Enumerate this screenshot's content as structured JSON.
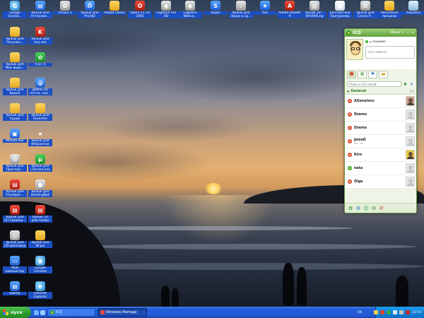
{
  "desktop_icons": [
    {
      "label": "Google Онлай...",
      "glyph": "G",
      "style": "g-globe",
      "icon": "google-online-icon"
    },
    {
      "label": "Ярлык для Установи...",
      "glyph": "▤",
      "style": "g-blue",
      "icon": "installer-shortcut-icon"
    },
    {
      "label": "Picasa 3",
      "glyph": "✿",
      "style": "g-gray",
      "icon": "picasa-icon"
    },
    {
      "label": "Ярлык для PrintID",
      "glyph": "⎙",
      "style": "g-blue",
      "icon": "printid-shortcut-icon"
    },
    {
      "label": "Новая папка",
      "glyph": "",
      "style": "g-folder",
      "icon": "folder-icon"
    },
    {
      "label": "Opera 11.10 2092",
      "glyph": "O",
      "style": "g-red",
      "icon": "opera-icon"
    },
    {
      "label": "Logitech Vid HD",
      "glyph": "◉",
      "style": "g-gray",
      "icon": "logitech-video-icon"
    },
    {
      "label": "Logitech Webca...",
      "glyph": "◉",
      "style": "g-gray",
      "icon": "logitech-webcam-icon"
    },
    {
      "label": "Skype",
      "glyph": "S",
      "style": "g-blue",
      "icon": "skype-icon"
    },
    {
      "label": "Ярлык для Звуки и ау...",
      "glyph": "♪",
      "style": "g-gray",
      "icon": "sounds-shortcut-icon"
    },
    {
      "label": "dvk",
      "glyph": "★",
      "style": "g-blue",
      "icon": "dvk-icon"
    },
    {
      "label": "Adobe Reader 9",
      "glyph": "A",
      "style": "g-red",
      "icon": "adobe-reader-icon"
    },
    {
      "label": "Архив ZIP - WinRAR.zip",
      "glyph": "▥",
      "style": "g-gray",
      "icon": "winrar-archive-icon"
    },
    {
      "label": "Бесплатные Программы Ру",
      "glyph": "▦",
      "style": "g-doc",
      "icon": "free-programs-icon"
    },
    {
      "label": "Ярлык для Canon P...",
      "glyph": "⎙",
      "style": "g-gray",
      "icon": "canon-shortcut-icon"
    },
    {
      "label": "Несколько ярлыков",
      "glyph": "",
      "style": "g-folder",
      "icon": "shortcuts-folder-icon"
    },
    {
      "label": "Корзина",
      "glyph": "",
      "style": "g-bin",
      "icon": "recycle-bin-icon"
    },
    {
      "label": "Ярлык для Рисунки...",
      "glyph": "",
      "style": "g-folder",
      "icon": "pictures-shortcut-icon"
    },
    {
      "label": "Ярлык для avp.exe",
      "glyph": "K",
      "style": "g-red",
      "icon": "avp-shortcut-icon"
    },
    {
      "label": "Ярлык для Мои виде...",
      "glyph": "",
      "style": "g-folder",
      "icon": "my-videos-shortcut-icon"
    },
    {
      "label": "ICQ7.4",
      "glyph": "✿",
      "style": "g-green",
      "icon": "icq-icon"
    },
    {
      "label": "Ярлык для Видео",
      "glyph": "",
      "style": "g-folder",
      "icon": "video-shortcut-icon"
    },
    {
      "label": "@MAIL.RU почта, нов...",
      "glyph": "@",
      "style": "g-blue",
      "icon": "mailru-icon"
    },
    {
      "label": "Ярлык для Аудио",
      "glyph": "",
      "style": "g-folder",
      "icon": "audio-shortcut-icon"
    },
    {
      "label": "Ярлык для Favorites",
      "glyph": "",
      "style": "g-folder",
      "icon": "favorites-shortcut-icon"
    },
    {
      "label": "MIPIDU.exe",
      "glyph": "▣",
      "style": "g-blue",
      "icon": "mipidu-icon"
    },
    {
      "label": "Ярлык для Избранное",
      "glyph": "★",
      "style": "g-star",
      "icon": "favorites-star-icon"
    },
    {
      "label": "Ярлык для Принтер...",
      "glyph": "⎙",
      "style": "g-gray",
      "icon": "printers-shortcut-icon"
    },
    {
      "label": "Ярлык для uTorrent.exe",
      "glyph": "µ",
      "style": "g-green",
      "icon": "utorrent-icon"
    },
    {
      "label": "Ярлык для FreeAgen...",
      "glyph": "▤",
      "style": "g-red",
      "icon": "freeagent-shortcut-icon"
    },
    {
      "label": "Ярлык для BowlingBall",
      "glyph": "●",
      "style": "g-gray",
      "icon": "bowling-shortcut-icon"
    },
    {
      "label": "Ярлык для (2) Сумины...",
      "glyph": "▤",
      "style": "g-red",
      "icon": "file-shortcut-icon"
    },
    {
      "label": "Ярлык (2) для папки",
      "glyph": "▤",
      "style": "g-red",
      "icon": "folder-shortcut-icon"
    },
    {
      "label": "Ярлык для CD-дисковод",
      "glyph": "◎",
      "style": "g-gray",
      "icon": "cd-drive-shortcut-icon"
    },
    {
      "label": "Ярлык для Игры",
      "glyph": "",
      "style": "g-folder",
      "icon": "games-shortcut-icon"
    },
    {
      "label": "Мой компьютер",
      "glyph": "▭",
      "style": "g-blue",
      "icon": "my-computer-icon"
    },
    {
      "label": "Google Chrome",
      "glyph": "◉",
      "style": "g-globe",
      "icon": "chrome-icon"
    },
    {
      "label": "bwlmp",
      "glyph": "▤",
      "style": "g-blue",
      "icon": "bwlmp-icon"
    },
    {
      "label": "Internet Explorer",
      "glyph": "e",
      "style": "g-globe",
      "icon": "internet-explorer-icon"
    }
  ],
  "icq": {
    "title": "ICQ",
    "menu_label": "Меню ▾",
    "nickname": "кошмил",
    "status_placeholder": "Что нового?",
    "search_placeholder": "Поиск в ICQ или Ф...",
    "group_name": "General",
    "group_count": "1/7",
    "contacts": [
      {
        "name": "AZenutsov",
        "sub": "",
        "status": "away",
        "photo": true
      },
      {
        "name": "Dzemo",
        "sub": "",
        "status": "away",
        "photo": false
      },
      {
        "name": "Dzemo",
        "sub": "",
        "status": "away",
        "photo": false
      },
      {
        "name": "JeizeD",
        "sub": "Вы. пр.",
        "status": "away",
        "photo": false
      },
      {
        "name": "Kiro",
        "sub": "",
        "status": "away",
        "photo": true
      },
      {
        "name": "nata",
        "sub": "",
        "status": "online",
        "photo": false
      },
      {
        "name": "Olga",
        "sub": "",
        "status": "away",
        "photo": false
      }
    ]
  },
  "taskbar": {
    "start_label": "пуск",
    "tasks": [
      {
        "label": "ICQ",
        "active": false
      },
      {
        "label": "Windows Mamage",
        "active": true
      }
    ],
    "language": "EN",
    "clock": "22:54"
  }
}
